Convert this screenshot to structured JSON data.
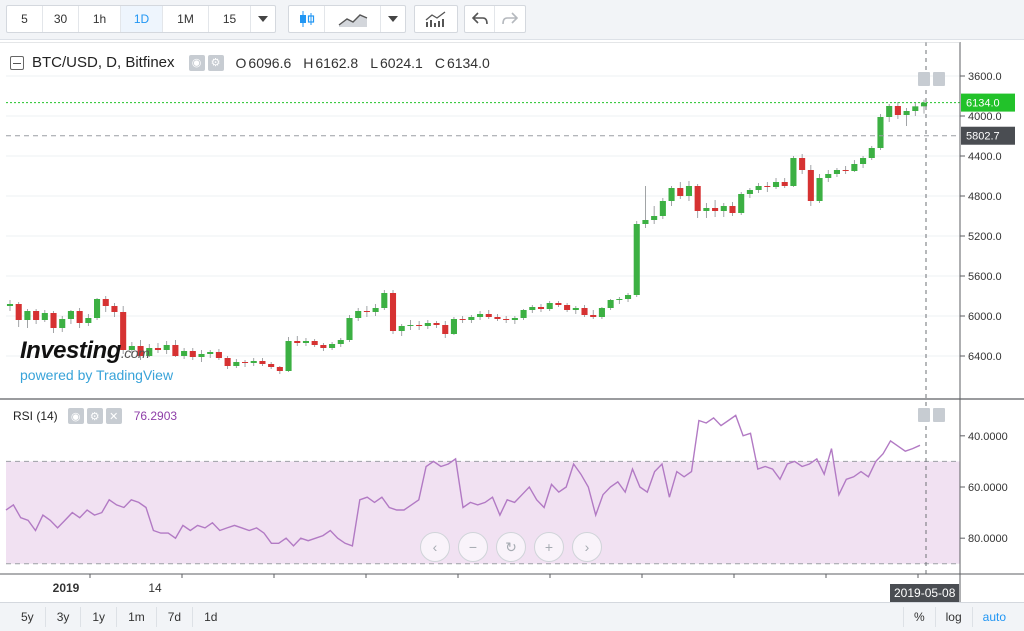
{
  "toolbar": {
    "intervals": [
      "5",
      "30",
      "1h",
      "1D",
      "1M",
      "15"
    ],
    "active_interval": "1D"
  },
  "legend": {
    "symbol": "BTC/USD, D, Bitfinex",
    "open_label": "O",
    "open": "6096.6",
    "high_label": "H",
    "high": "6162.8",
    "low_label": "L",
    "low": "6024.1",
    "close_label": "C",
    "close": "6134.0"
  },
  "rsi_legend": {
    "name": "RSI (14)",
    "value": "76.2903"
  },
  "watermark": {
    "logo": "Investing",
    "logo_suffix": ".com",
    "sub": "powered by TradingView"
  },
  "price_axis": {
    "ticks": [
      "6400.0",
      "6000.0",
      "5600.0",
      "5200.0",
      "4800.0",
      "4400.0",
      "4000.0",
      "3600.0"
    ],
    "last_price": "6134.0",
    "crosshair_price": "5802.7"
  },
  "rsi_axis": {
    "ticks": [
      "80.0000",
      "60.0000",
      "40.0000"
    ]
  },
  "time_axis": {
    "ticks": [
      "2019",
      "14"
    ],
    "crosshair_date": "2019-05-08"
  },
  "bottom": {
    "ranges": [
      "5y",
      "3y",
      "1y",
      "1m",
      "7d",
      "1d"
    ],
    "scale_options": [
      "%",
      "log",
      "auto"
    ],
    "active_scale": "auto"
  },
  "colors": {
    "up": "#3cb043",
    "down": "#d63232",
    "rsi_line": "#b27ac4",
    "rsi_band": "#f1e1f2",
    "last_price": "#22c22a",
    "accent": "#2196f3"
  },
  "chart_data": [
    {
      "type": "candlestick",
      "title": "BTC/USD, D, Bitfinex",
      "ylim": [
        3300,
        6600
      ],
      "y_ticks": [
        3600,
        4000,
        4400,
        4800,
        5200,
        5600,
        6000,
        6400
      ],
      "x_tick_labels": [
        "2019",
        "14"
      ],
      "ohlc": [
        [
          4100,
          4160,
          4050,
          4120
        ],
        [
          4120,
          4140,
          3890,
          3960
        ],
        [
          3960,
          4070,
          3880,
          4050
        ],
        [
          4050,
          4070,
          3920,
          3960
        ],
        [
          3960,
          4060,
          3940,
          4030
        ],
        [
          4030,
          4050,
          3830,
          3880
        ],
        [
          3880,
          4000,
          3840,
          3970
        ],
        [
          3970,
          4060,
          3920,
          4050
        ],
        [
          4050,
          4080,
          3880,
          3930
        ],
        [
          3930,
          4020,
          3900,
          3980
        ],
        [
          3980,
          4180,
          3960,
          4170
        ],
        [
          4170,
          4200,
          4040,
          4100
        ],
        [
          4100,
          4130,
          3990,
          4040
        ],
        [
          4040,
          4100,
          3620,
          3660
        ],
        [
          3660,
          3740,
          3600,
          3700
        ],
        [
          3700,
          3760,
          3560,
          3600
        ],
        [
          3600,
          3720,
          3590,
          3680
        ],
        [
          3680,
          3730,
          3630,
          3660
        ],
        [
          3660,
          3750,
          3620,
          3710
        ],
        [
          3710,
          3760,
          3590,
          3600
        ],
        [
          3600,
          3680,
          3570,
          3650
        ],
        [
          3650,
          3680,
          3560,
          3590
        ],
        [
          3590,
          3660,
          3540,
          3620
        ],
        [
          3620,
          3660,
          3580,
          3640
        ],
        [
          3640,
          3670,
          3560,
          3580
        ],
        [
          3580,
          3600,
          3470,
          3500
        ],
        [
          3500,
          3570,
          3480,
          3540
        ],
        [
          3540,
          3560,
          3490,
          3530
        ],
        [
          3530,
          3580,
          3500,
          3550
        ],
        [
          3550,
          3580,
          3500,
          3520
        ],
        [
          3520,
          3540,
          3470,
          3490
        ],
        [
          3490,
          3500,
          3420,
          3450
        ],
        [
          3450,
          3790,
          3440,
          3750
        ],
        [
          3750,
          3800,
          3700,
          3730
        ],
        [
          3730,
          3780,
          3700,
          3750
        ],
        [
          3750,
          3770,
          3690,
          3710
        ],
        [
          3710,
          3730,
          3650,
          3680
        ],
        [
          3680,
          3740,
          3660,
          3720
        ],
        [
          3720,
          3780,
          3690,
          3760
        ],
        [
          3760,
          4010,
          3740,
          3980
        ],
        [
          3980,
          4080,
          3950,
          4050
        ],
        [
          4050,
          4100,
          3990,
          4040
        ],
        [
          4040,
          4120,
          4000,
          4080
        ],
        [
          4080,
          4260,
          4060,
          4230
        ],
        [
          4230,
          4260,
          3820,
          3850
        ],
        [
          3850,
          3920,
          3800,
          3900
        ],
        [
          3900,
          3960,
          3860,
          3910
        ],
        [
          3910,
          3950,
          3860,
          3900
        ],
        [
          3900,
          3960,
          3870,
          3930
        ],
        [
          3930,
          3950,
          3880,
          3910
        ],
        [
          3910,
          3950,
          3780,
          3820
        ],
        [
          3820,
          3990,
          3810,
          3970
        ],
        [
          3970,
          4000,
          3930,
          3960
        ],
        [
          3960,
          4010,
          3930,
          3990
        ],
        [
          3990,
          4050,
          3960,
          4020
        ],
        [
          4020,
          4060,
          3970,
          3990
        ],
        [
          3990,
          4020,
          3950,
          3970
        ],
        [
          3970,
          4000,
          3930,
          3960
        ],
        [
          3960,
          4000,
          3920,
          3980
        ],
        [
          3980,
          4070,
          3960,
          4060
        ],
        [
          4060,
          4110,
          4030,
          4090
        ],
        [
          4090,
          4120,
          4040,
          4070
        ],
        [
          4070,
          4150,
          4050,
          4130
        ],
        [
          4130,
          4150,
          4090,
          4110
        ],
        [
          4110,
          4130,
          4040,
          4060
        ],
        [
          4060,
          4100,
          4020,
          4080
        ],
        [
          4080,
          4110,
          3990,
          4010
        ],
        [
          4010,
          4060,
          3970,
          3990
        ],
        [
          3990,
          4090,
          3970,
          4080
        ],
        [
          4080,
          4170,
          4060,
          4160
        ],
        [
          4160,
          4190,
          4120,
          4170
        ],
        [
          4170,
          4230,
          4140,
          4210
        ],
        [
          4210,
          4950,
          4190,
          4920
        ],
        [
          4920,
          5300,
          4880,
          4960
        ],
        [
          4960,
          5100,
          4920,
          5000
        ],
        [
          5000,
          5180,
          4970,
          5150
        ],
        [
          5150,
          5300,
          5100,
          5280
        ],
        [
          5280,
          5340,
          5170,
          5200
        ],
        [
          5200,
          5350,
          5150,
          5300
        ],
        [
          5300,
          5320,
          4980,
          5050
        ],
        [
          5050,
          5130,
          4980,
          5080
        ],
        [
          5080,
          5160,
          4990,
          5050
        ],
        [
          5050,
          5130,
          4990,
          5100
        ],
        [
          5100,
          5140,
          5000,
          5030
        ],
        [
          5030,
          5240,
          5010,
          5220
        ],
        [
          5220,
          5280,
          5180,
          5260
        ],
        [
          5260,
          5330,
          5230,
          5300
        ],
        [
          5300,
          5340,
          5240,
          5290
        ],
        [
          5290,
          5380,
          5270,
          5340
        ],
        [
          5340,
          5380,
          5280,
          5300
        ],
        [
          5300,
          5600,
          5290,
          5580
        ],
        [
          5580,
          5620,
          5420,
          5460
        ],
        [
          5460,
          5510,
          5100,
          5150
        ],
        [
          5150,
          5420,
          5130,
          5380
        ],
        [
          5380,
          5460,
          5340,
          5420
        ],
        [
          5420,
          5480,
          5390,
          5460
        ],
        [
          5460,
          5500,
          5420,
          5450
        ],
        [
          5450,
          5560,
          5440,
          5520
        ],
        [
          5520,
          5600,
          5480,
          5580
        ],
        [
          5580,
          5700,
          5560,
          5680
        ],
        [
          5680,
          6020,
          5660,
          5990
        ],
        [
          5990,
          6120,
          5940,
          6100
        ],
        [
          6100,
          6140,
          5970,
          6010
        ],
        [
          6010,
          6080,
          5900,
          6050
        ],
        [
          6050,
          6130,
          6000,
          6096.6
        ],
        [
          6096.6,
          6162.8,
          6024.1,
          6134.0
        ]
      ]
    },
    {
      "type": "line",
      "title": "RSI (14)",
      "ylim": [
        26,
        94
      ],
      "y_ticks": [
        40,
        60,
        80
      ],
      "bands": [
        30,
        70
      ],
      "series": [
        {
          "name": "RSI (14)",
          "values": [
            51,
            53,
            48,
            47,
            43,
            49,
            47,
            44,
            47,
            50,
            48,
            51,
            49,
            50,
            55,
            53,
            52,
            55,
            54,
            52,
            43,
            42,
            42,
            40,
            45,
            43,
            45,
            44,
            46,
            43,
            44,
            45,
            44,
            43,
            44,
            42,
            38,
            38,
            40,
            37,
            40,
            39,
            40,
            41,
            43,
            40,
            38,
            37,
            55,
            56,
            54,
            56,
            52,
            51,
            51,
            53,
            55,
            68,
            70,
            68,
            69,
            71,
            52,
            54,
            53,
            54,
            56,
            49,
            55,
            54,
            57,
            60,
            55,
            52,
            61,
            58,
            60,
            69,
            65,
            60,
            49,
            57,
            60,
            62,
            58,
            67,
            60,
            58,
            66,
            69,
            56,
            66,
            64,
            66,
            86,
            85,
            87,
            84,
            86,
            88,
            80,
            81,
            67,
            68,
            67,
            63,
            69,
            70,
            68,
            69,
            71,
            65,
            75,
            57,
            63,
            64,
            66,
            64,
            70,
            73,
            78,
            76,
            74,
            75,
            76.29
          ]
        }
      ]
    }
  ]
}
